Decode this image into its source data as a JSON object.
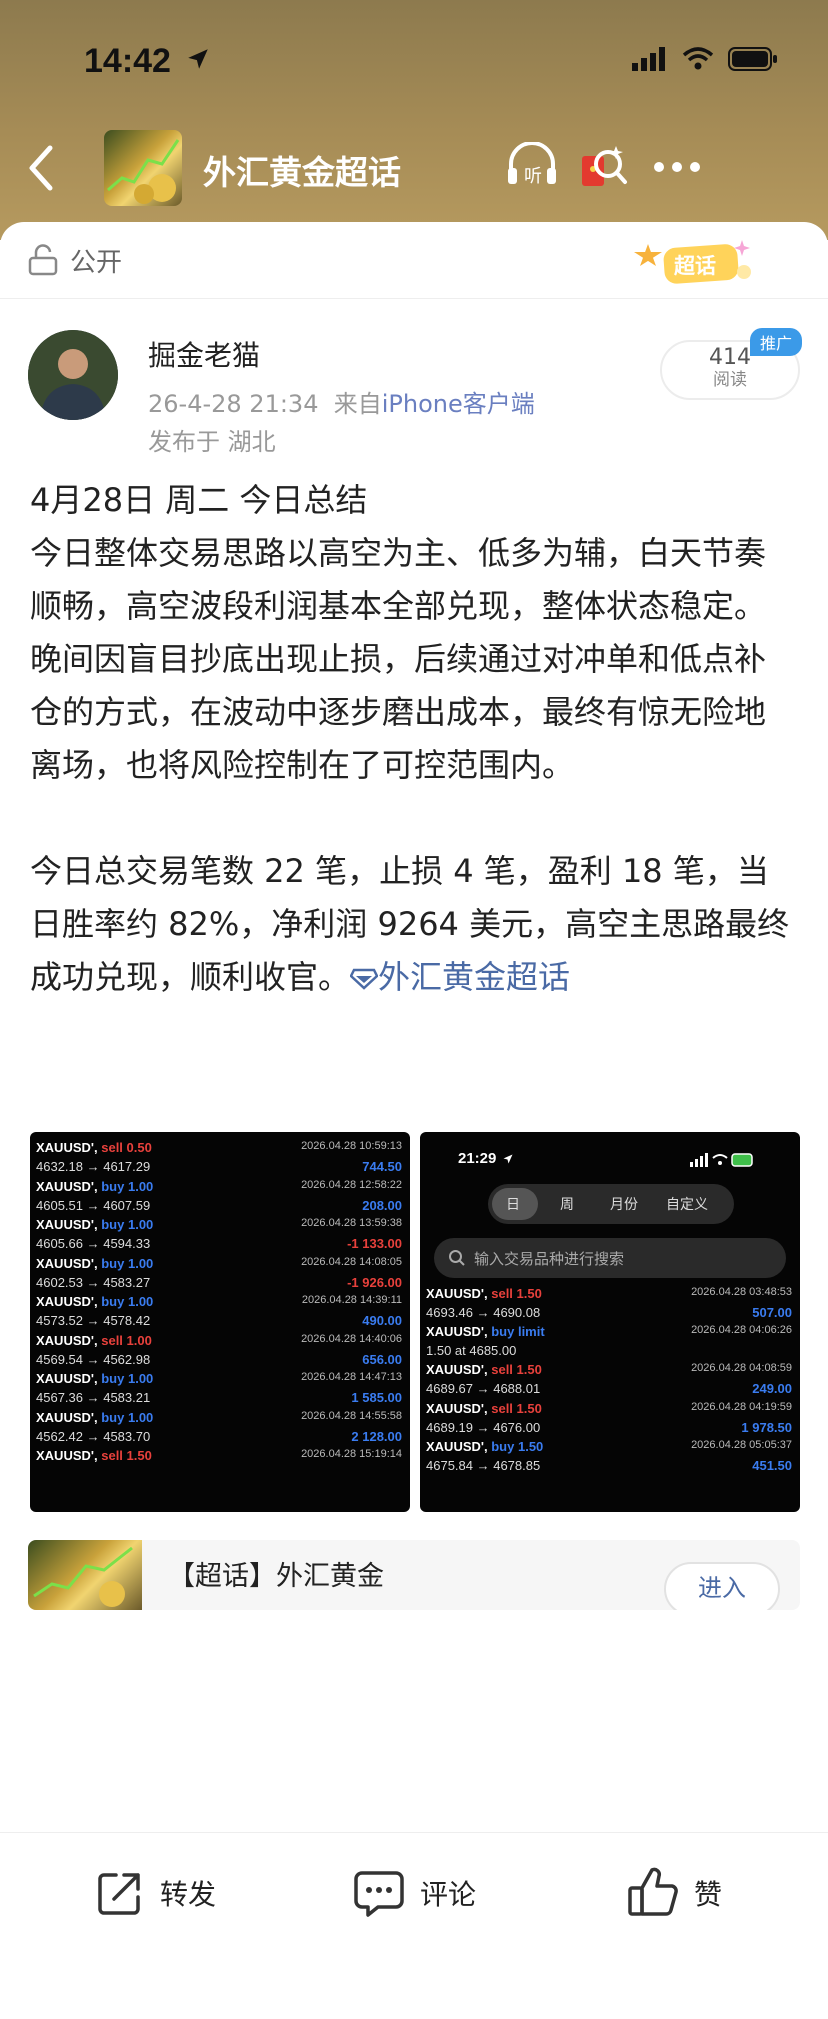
{
  "status_bar": {
    "time": "14:42"
  },
  "header": {
    "title": "外汇黄金超话",
    "listen_label": "听"
  },
  "visibility": {
    "label": "公开",
    "badge": "超话"
  },
  "post": {
    "author": "掘金老猫",
    "datetime": "26-4-28 21:34",
    "source_prefix": "来自",
    "source": "iPhone客户端",
    "location": "发布于 湖北",
    "reads": "414",
    "reads_label": "阅读",
    "promo": "推广",
    "heading": "4月28日 周二 今日总结",
    "para1": "今日整体交易思路以高空为主、低多为辅，白天节奏顺畅，高空波段利润基本全部兑现，整体状态稳定。晚间因盲目抄底出现止损，后续通过对冲单和低点补仓的方式，在波动中逐步磨出成本，最终有惊无险地离场，也将风险控制在了可控范围内。",
    "para2": "今日总交易笔数 22 笔，止损 4 笔，盈利 18 笔，当日胜率约 82%，净利润 9264 美元，高空主思路最终成功兑现，顺利收官。",
    "topic_link": "外汇黄金超话"
  },
  "screenshot1": {
    "trades": [
      {
        "symbol": "XAUUSD'",
        "side": "sell",
        "lots": "0.50",
        "date": "2026.04.28 10:59:13",
        "prices": "4632.18 → 4617.29",
        "pl": "744.50",
        "pl_sign": "pos"
      },
      {
        "symbol": "XAUUSD'",
        "side": "buy",
        "lots": "1.00",
        "date": "2026.04.28 12:58:22",
        "prices": "4605.51 → 4607.59",
        "pl": "208.00",
        "pl_sign": "pos"
      },
      {
        "symbol": "XAUUSD'",
        "side": "buy",
        "lots": "1.00",
        "date": "2026.04.28 13:59:38",
        "prices": "4605.66 → 4594.33",
        "pl": "-1 133.00",
        "pl_sign": "neg"
      },
      {
        "symbol": "XAUUSD'",
        "side": "buy",
        "lots": "1.00",
        "date": "2026.04.28 14:08:05",
        "prices": "4602.53 → 4583.27",
        "pl": "-1 926.00",
        "pl_sign": "neg"
      },
      {
        "symbol": "XAUUSD'",
        "side": "buy",
        "lots": "1.00",
        "date": "2026.04.28 14:39:11",
        "prices": "4573.52 → 4578.42",
        "pl": "490.00",
        "pl_sign": "pos"
      },
      {
        "symbol": "XAUUSD'",
        "side": "sell",
        "lots": "1.00",
        "date": "2026.04.28 14:40:06",
        "prices": "4569.54 → 4562.98",
        "pl": "656.00",
        "pl_sign": "pos"
      },
      {
        "symbol": "XAUUSD'",
        "side": "buy",
        "lots": "1.00",
        "date": "2026.04.28 14:47:13",
        "prices": "4567.36 → 4583.21",
        "pl": "1 585.00",
        "pl_sign": "pos"
      },
      {
        "symbol": "XAUUSD'",
        "side": "buy",
        "lots": "1.00",
        "date": "2026.04.28 14:55:58",
        "prices": "4562.42 → 4583.70",
        "pl": "2 128.00",
        "pl_sign": "pos"
      },
      {
        "symbol": "XAUUSD'",
        "side": "sell",
        "lots": "1.50",
        "date": "2026.04.28 15:19:14",
        "prices": "",
        "pl": "",
        "pl_sign": "pos"
      }
    ]
  },
  "screenshot2": {
    "time": "21:29",
    "segments": [
      "日",
      "周",
      "月份",
      "自定义"
    ],
    "search_placeholder": "输入交易品种进行搜索",
    "trades": [
      {
        "symbol": "XAUUSD'",
        "side": "sell",
        "lots": "1.50",
        "date": "2026.04.28 03:48:53",
        "prices": "4693.46 → 4690.08",
        "pl": "507.00",
        "pl_sign": "pos"
      },
      {
        "symbol": "XAUUSD'",
        "side": "buy limit",
        "lots": "",
        "date": "2026.04.28 04:06:26",
        "prices": "1.50 at 4685.00",
        "pl": "",
        "pl_sign": "pos"
      },
      {
        "symbol": "XAUUSD'",
        "side": "sell",
        "lots": "1.50",
        "date": "2026.04.28 04:08:59",
        "prices": "4689.67 → 4688.01",
        "pl": "249.00",
        "pl_sign": "pos"
      },
      {
        "symbol": "XAUUSD'",
        "side": "sell",
        "lots": "1.50",
        "date": "2026.04.28 04:19:59",
        "prices": "4689.19 → 4676.00",
        "pl": "1 978.50",
        "pl_sign": "pos"
      },
      {
        "symbol": "XAUUSD'",
        "side": "buy",
        "lots": "1.50",
        "date": "2026.04.28 05:05:37",
        "prices": "4675.84 → 4678.85",
        "pl": "451.50",
        "pl_sign": "pos"
      }
    ]
  },
  "group_card": {
    "title": "【超话】外汇黄金",
    "enter_label": "进入"
  },
  "bottom_bar": {
    "repost": "转发",
    "comment": "评论",
    "like": "赞"
  }
}
